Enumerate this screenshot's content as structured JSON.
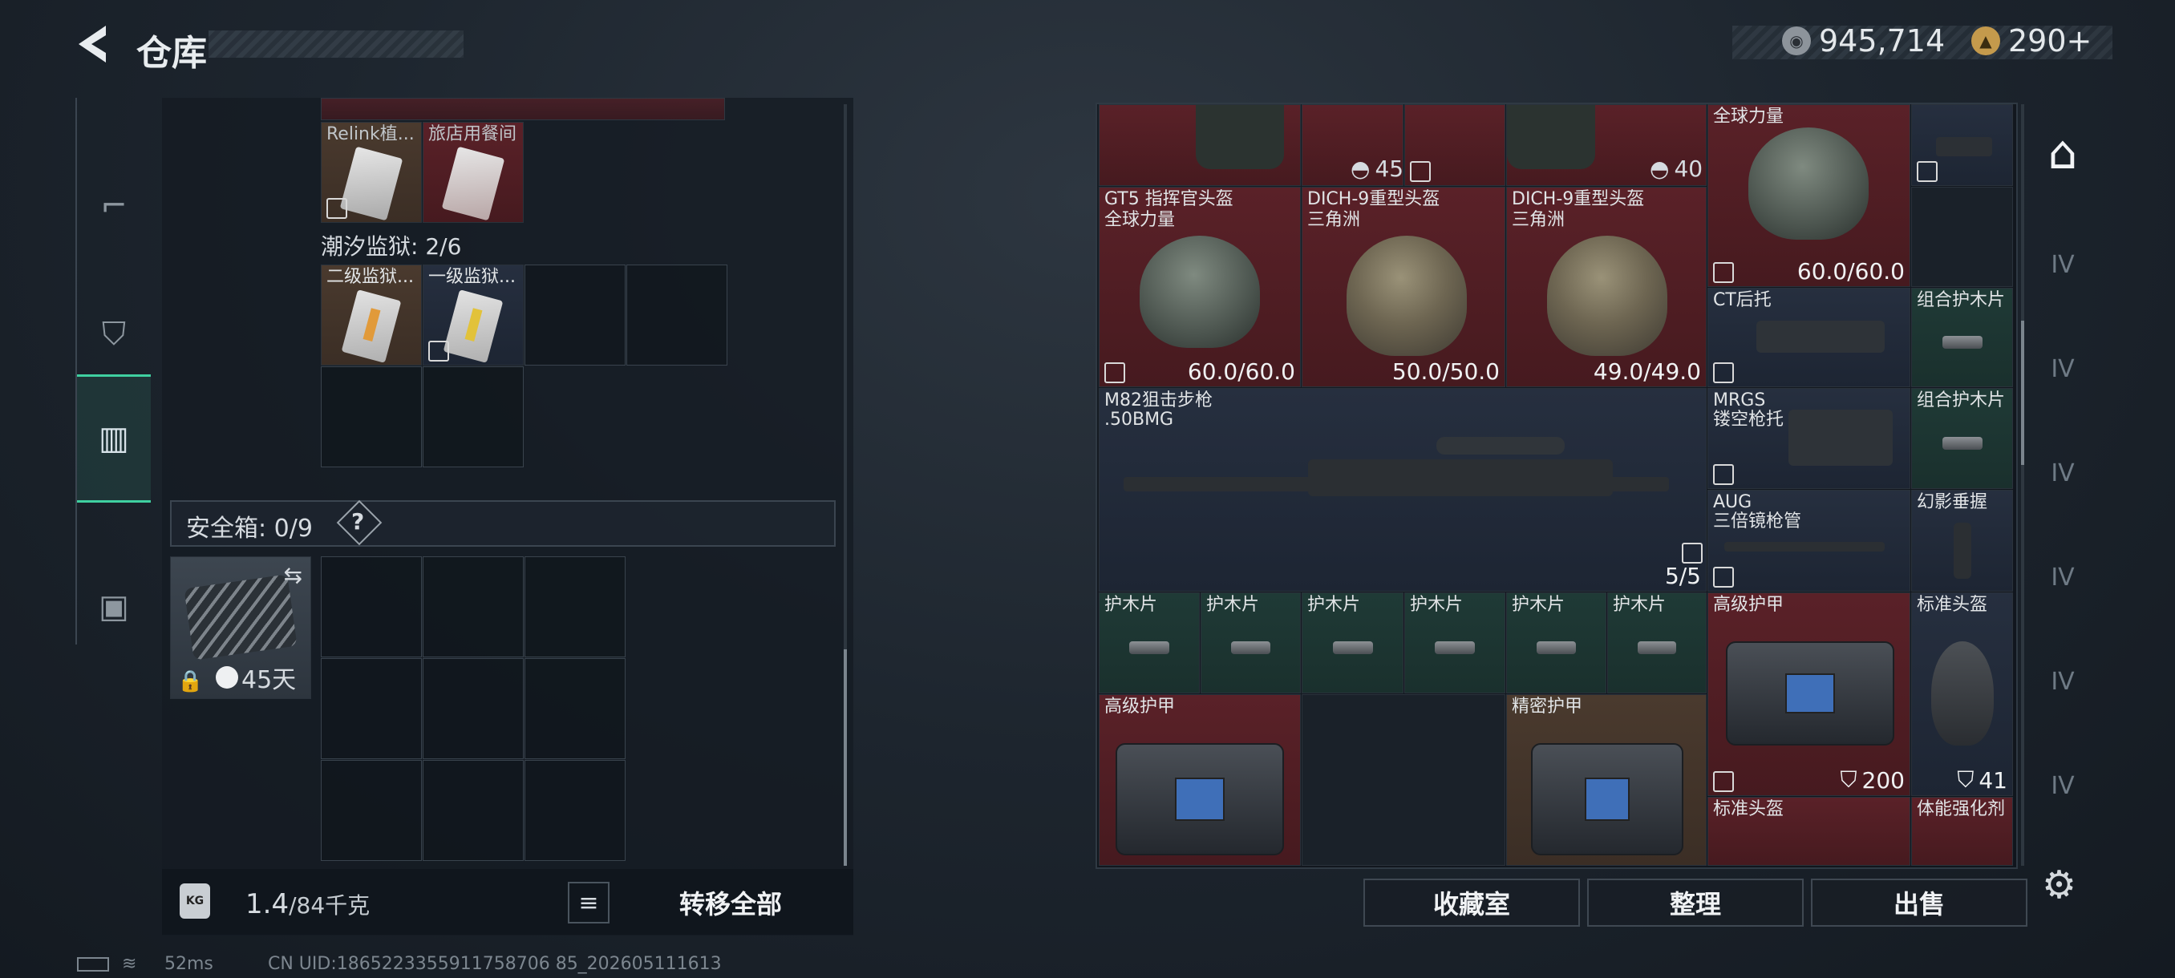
{
  "header": {
    "title": "仓库",
    "currency1": "945,714",
    "currency2": "290+"
  },
  "left_tabs": [
    {
      "icon": "gun-icon"
    },
    {
      "icon": "backpack-icon"
    },
    {
      "icon": "vest-icon"
    },
    {
      "icon": "briefcase-icon"
    }
  ],
  "left": {
    "top_items": [
      {
        "name": "Relink植...",
        "color": "brown"
      },
      {
        "name": "旅店用餐间",
        "color": "red"
      }
    ],
    "prison_label": "潮汐监狱: 2/6",
    "prison_items": [
      {
        "name": "二级监狱...",
        "color": "brown"
      },
      {
        "name": "一级监狱...",
        "color": "navy"
      }
    ],
    "safe_label": "安全箱: 0/9",
    "safe_help": "?",
    "safe_timer": "45天",
    "weight": "1.4",
    "weight_max": "/84千克",
    "transfer_all": "转移全部"
  },
  "right": {
    "top_values": [
      "45",
      "40"
    ],
    "helmets": [
      {
        "name": "GT5 指挥官头盔",
        "sub": "全球力量",
        "value": "60.0/60.0"
      },
      {
        "name": "DICH-9重型头盔",
        "sub": "三角洲",
        "value": "50.0/50.0"
      },
      {
        "name": "DICH-9重型头盔",
        "sub": "三角洲",
        "value": "49.0/49.0"
      },
      {
        "name": "",
        "sub": "全球力量",
        "value": "60.0/60.0"
      }
    ],
    "ct_stock": "CT后托",
    "handguard1": "组合护木片",
    "sniper": {
      "name": "M82狙击步枪",
      "sub": ".50BMG",
      "value": "5/5"
    },
    "mrgs": {
      "name": "MRGS",
      "sub": "镂空枪托"
    },
    "handguard2": "组合护木片",
    "aug": {
      "name": "AUG",
      "sub": "三倍镜枪管"
    },
    "grip": "幻影垂握",
    "small_plates": [
      "护木片",
      "护木片",
      "护木片",
      "护木片",
      "护木片",
      "护木片"
    ],
    "armor1": {
      "name": "高级护甲",
      "value": "200"
    },
    "helmet_std": {
      "name": "标准头盔",
      "value": "41"
    },
    "armor2": "高级护甲",
    "armor3": "精密护甲",
    "helmet_std2": "标准头盔",
    "stim": "体能强化剂",
    "buttons": [
      "收藏室",
      "整理",
      "出售"
    ]
  },
  "right_tabs": [
    "IV",
    "IV",
    "IV",
    "IV",
    "IV",
    "IV"
  ],
  "status": {
    "ping": "52ms",
    "uid": "CN UID:1865223355911758706 85_202605111613"
  }
}
